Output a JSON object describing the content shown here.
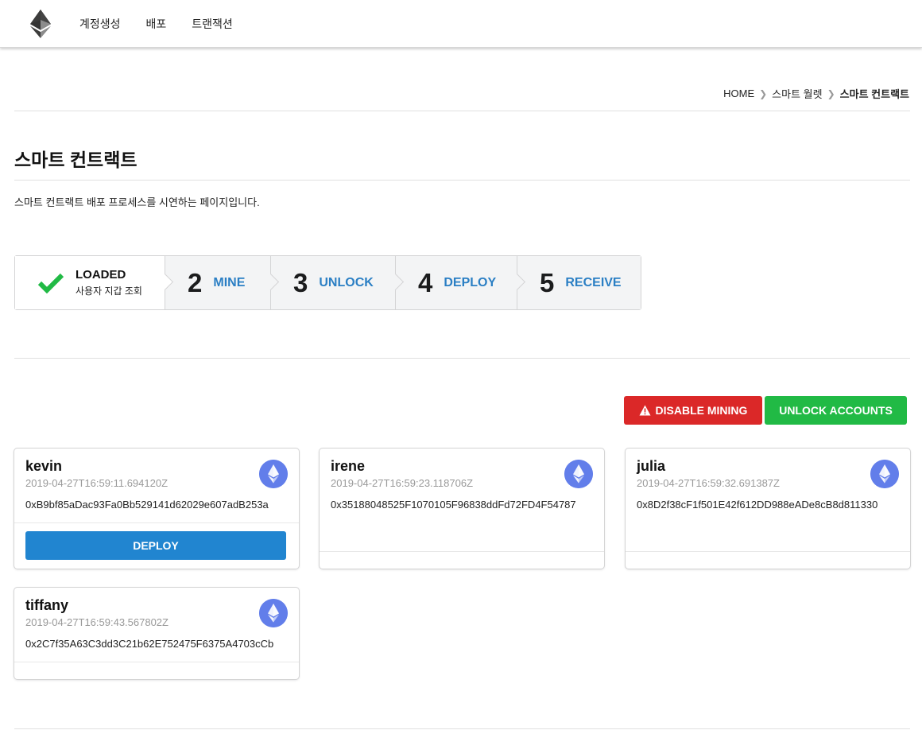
{
  "nav": {
    "items": [
      "계정생성",
      "배포",
      "트랜잭션"
    ]
  },
  "breadcrumb": {
    "home": "HOME",
    "wallet": "스마트 월렛",
    "current": "스마트 컨트랙트"
  },
  "page": {
    "title": "스마트 컨트랙트",
    "description": "스마트 컨트랙트 배포 프로세스를 시연하는 페이지입니다."
  },
  "steps": {
    "loaded_title": "LOADED",
    "loaded_sub": "사용자 지갑 조회",
    "mine_num": "2",
    "mine_label": "MINE",
    "unlock_num": "3",
    "unlock_label": "UNLOCK",
    "deploy_num": "4",
    "deploy_label": "DEPLOY",
    "receive_num": "5",
    "receive_label": "RECEIVE"
  },
  "actions": {
    "disable_mining": "DISABLE MINING",
    "unlock_accounts": "UNLOCK ACCOUNTS"
  },
  "accounts": [
    {
      "name": "kevin",
      "date": "2019-04-27T16:59:11.694120Z",
      "address": "0xB9bf85aDac93Fa0Bb529141d62029e607adB253a",
      "deploy_label": "DEPLOY"
    },
    {
      "name": "irene",
      "date": "2019-04-27T16:59:23.118706Z",
      "address": "0x35188048525F1070105F96838ddFd72FD4F54787"
    },
    {
      "name": "julia",
      "date": "2019-04-27T16:59:32.691387Z",
      "address": "0x8D2f38cF1f501E42f612DD988eADe8cB8d811330"
    },
    {
      "name": "tiffany",
      "date": "2019-04-27T16:59:43.567802Z",
      "address": "0x2C7f35A63C3dd3C21b62E752475F6375A4703cCb"
    }
  ],
  "colors": {
    "step_link": "#2b7fc4",
    "check": "#21ba45",
    "danger": "#db2828",
    "success": "#21ba45",
    "primary": "#2185d0",
    "eth": "#627eea"
  },
  "icons": [
    "ethereum-logo-icon",
    "chevron-right-icon",
    "check-icon",
    "warning-icon",
    "ethereum-icon"
  ]
}
